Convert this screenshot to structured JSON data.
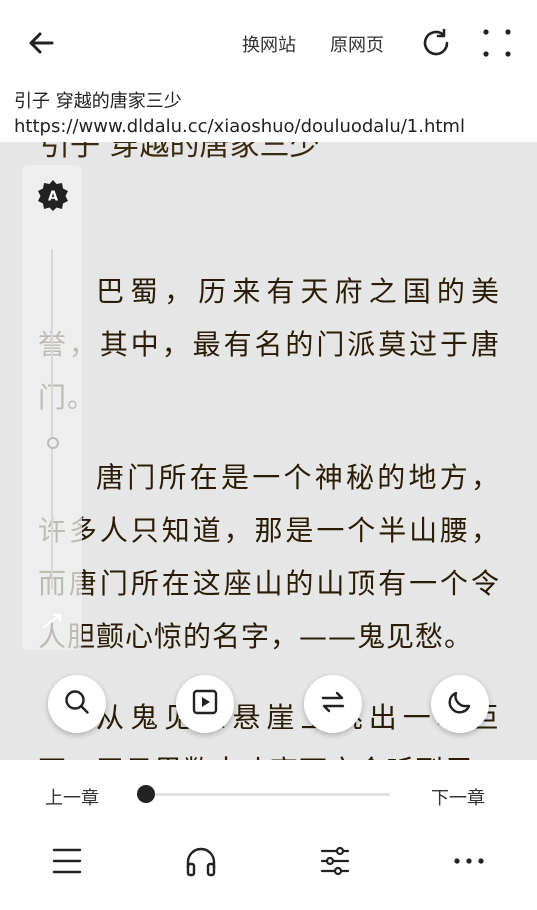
{
  "toolbar": {
    "switch_site": "换网站",
    "original_page": "原网页"
  },
  "page": {
    "chapter_title": "引子 穿越的唐家三少",
    "url": "https://www.dldalu.cc/xiaoshuo/douluodalu/1.html",
    "peek_title": "引子 穿越的唐家三少"
  },
  "content": {
    "paragraphs": [
      "巴蜀，历来有天府之国的美誉，其中，最有名的门派莫过于唐门。",
      "唐门所在是一个神秘的地方，许多人只知道，那是一个半山腰，而唐门所在这座山的山顶有一个令人胆颤心惊的名字，——鬼见愁。",
      "从鬼见愁悬崖上跳出一块巨石，平日里数十丈高下方会听到巨"
    ]
  },
  "brightness": {
    "level": 0.55
  },
  "chapter_nav": {
    "prev": "上一章",
    "next": "下一章",
    "progress": 0.0
  },
  "floating_buttons": [
    "search-icon",
    "autoplay-icon",
    "swap-icon",
    "night-mode-icon"
  ],
  "bottom_nav": [
    "menu-icon",
    "headphones-icon",
    "settings-icon",
    "more-icon"
  ],
  "colors": {
    "background": "#e6e6e6",
    "text": "#2b1d05",
    "bar": "#ffffff"
  }
}
